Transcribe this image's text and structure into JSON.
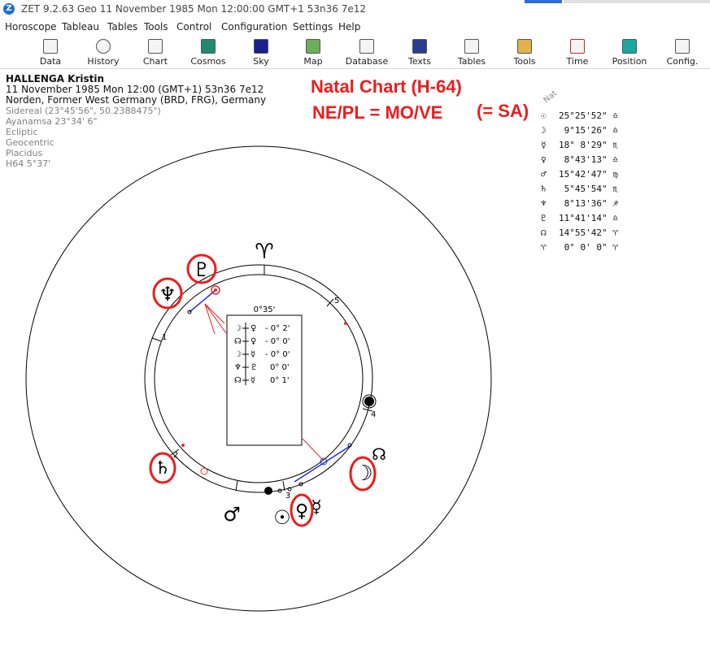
{
  "window": {
    "title": "ZET 9.2.63 Geo   11 November 1985  Mon  12:00:00 GMT+1 53n36  7e12"
  },
  "menu": [
    "Horoscope",
    "Tableau",
    "Tables",
    "Tools",
    "Control",
    "Configuration",
    "Settings",
    "Help"
  ],
  "toolbar": [
    {
      "label": "Data",
      "icon": "data-icon"
    },
    {
      "label": "History",
      "icon": "history-icon"
    },
    {
      "label": "Chart",
      "icon": "chart-icon"
    },
    {
      "label": "Cosmos",
      "icon": "cosmos-icon"
    },
    {
      "label": "Sky",
      "icon": "sky-icon"
    },
    {
      "label": "Map",
      "icon": "map-icon"
    },
    {
      "label": "Database",
      "icon": "database-icon"
    },
    {
      "label": "Texts",
      "icon": "texts-icon"
    },
    {
      "label": "Tables",
      "icon": "tables-icon"
    },
    {
      "label": "Tools",
      "icon": "tools-icon"
    },
    {
      "label": "Time",
      "icon": "time-icon"
    },
    {
      "label": "Position",
      "icon": "position-icon"
    },
    {
      "label": "Config.",
      "icon": "config-icon"
    }
  ],
  "info": {
    "name": "HALLENGA Kristin",
    "date_line": "11 November 1985  Mon  12:00 (GMT+1) 53n36  7e12",
    "place": "Norden, Former West Germany (BRD, FRG), Germany",
    "details": [
      "Sidereal (23°45'56\", 50.2388475\")",
      "Ayanamsa 23°34' 6\"",
      "Ecliptic",
      "Geocentric",
      "Placidus",
      "H64   5°37'"
    ]
  },
  "annotation": {
    "title": "Natal Chart (H-64)",
    "formula": "NE/PL = MO/VE",
    "note": "(= SA)"
  },
  "positions_header": "Nat",
  "positions": [
    {
      "symbol": "☉",
      "value": "25°25'52\"",
      "sign": "♎"
    },
    {
      "symbol": "☽",
      "value": " 9°15'26\"",
      "sign": "♎"
    },
    {
      "symbol": "☿",
      "value": "18° 8'29\"",
      "sign": "♏"
    },
    {
      "symbol": "♀",
      "value": " 8°43'13\"",
      "sign": "♎"
    },
    {
      "symbol": "♂",
      "value": "15°42'47\"",
      "sign": "♍"
    },
    {
      "symbol": "♄",
      "value": " 5°45'54\"",
      "sign": "♏"
    },
    {
      "symbol": "♆",
      "value": " 8°13'36\"",
      "sign": "♐"
    },
    {
      "symbol": "♇",
      "value": "11°41'14\"",
      "sign": "♎"
    },
    {
      "symbol": "☊",
      "value": "14°55'42\"",
      "sign": "♈"
    },
    {
      "symbol": "♈",
      "value": " 0° 0' 0\"",
      "sign": "♈"
    }
  ],
  "chart": {
    "box_header": "0°35'",
    "aspects": [
      {
        "p1": "☽",
        "p2": "♀",
        "value": "- 0° 2'"
      },
      {
        "p1": "☊",
        "p2": "♀",
        "value": "- 0° 0'"
      },
      {
        "p1": "☽",
        "p2": "☿",
        "value": "- 0° 0'"
      },
      {
        "p1": "♆",
        "p2": "♇",
        "value": "0° 0'"
      },
      {
        "p1": "☊",
        "p2": "☿",
        "value": "0° 1'"
      }
    ],
    "house_numbers": [
      "1",
      "2",
      "3",
      "4",
      "5"
    ],
    "aries_glyph": "♈",
    "glyphs": {
      "pluto": "♇",
      "neptune": "♆",
      "saturn": "♄",
      "mars": "♂",
      "sun": "☉",
      "venus": "♀",
      "mercury": "☿",
      "moon": "☽",
      "node": "☊"
    }
  },
  "colors": {
    "highlight": "#ee1c1c",
    "axis_blue": "#1f2be0",
    "chart_line": "#000000"
  }
}
